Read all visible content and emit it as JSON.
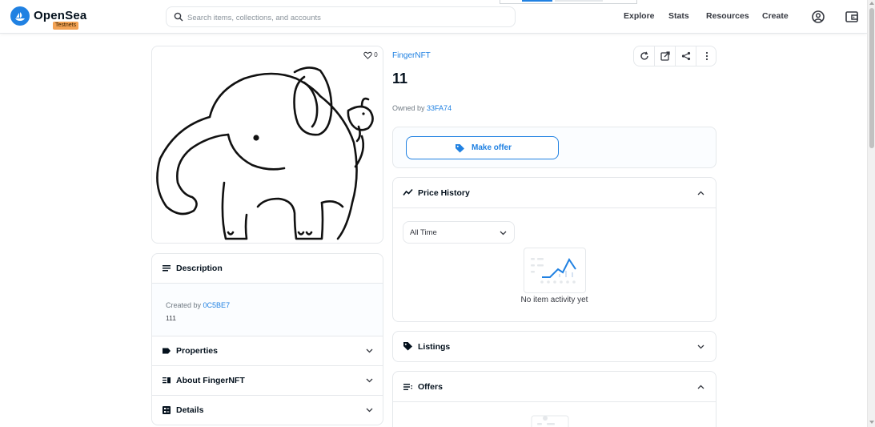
{
  "header": {
    "brand": "OpenSea",
    "badge": "Testnets",
    "search_placeholder": "Search items, collections, and accounts",
    "nav": [
      "Explore",
      "Stats",
      "Resources",
      "Create"
    ]
  },
  "asset": {
    "favorites": "0",
    "collection": "FingerNFT",
    "name": "11",
    "owned_by_label": "Owned by",
    "owner": "33FA74"
  },
  "offer": {
    "button": "Make offer"
  },
  "price_history": {
    "title": "Price History",
    "range": "All Time",
    "empty": "No item activity yet"
  },
  "listings": {
    "title": "Listings"
  },
  "offers": {
    "title": "Offers"
  },
  "left": {
    "description_title": "Description",
    "created_by_label": "Created by",
    "creator": "0C5BE7",
    "description": "111",
    "properties_title": "Properties",
    "about_title": "About FingerNFT",
    "details_title": "Details"
  },
  "colors": {
    "accent": "#2081e2",
    "badge": "#f2a254"
  }
}
